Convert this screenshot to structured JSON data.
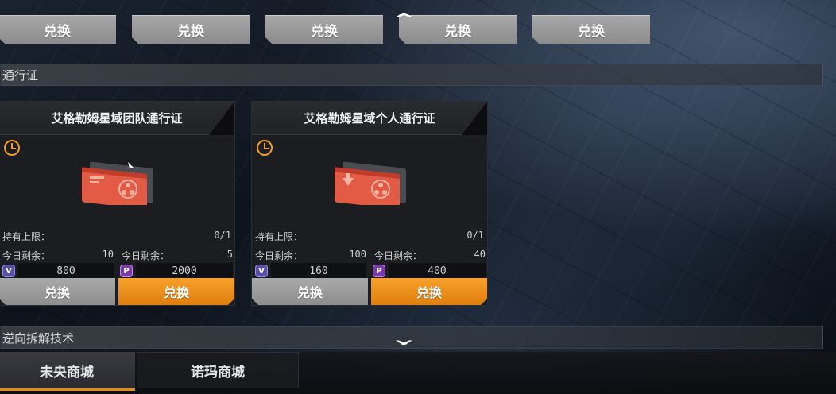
{
  "top_row": {
    "buttons": [
      "兑换",
      "兑换",
      "兑换",
      "兑换",
      "兑换"
    ]
  },
  "sections": {
    "pass": "通行证",
    "reverse": "逆向拆解技术"
  },
  "cards": [
    {
      "title": "艾格勒姆星域团队通行证",
      "hold_label": "持有上限：",
      "hold_value": "0/1",
      "today_label_1": "今日剩余：",
      "today_value_1": "10",
      "today_label_2": "今日剩余：",
      "today_value_2": "5",
      "price_1": "800",
      "price_2": "2000",
      "btn_1": "兑换",
      "btn_2": "兑换"
    },
    {
      "title": "艾格勒姆星域个人通行证",
      "hold_label": "持有上限：",
      "hold_value": "0/1",
      "today_label_1": "今日剩余：",
      "today_value_1": "100",
      "today_label_2": "今日剩余：",
      "today_value_2": "40",
      "price_1": "160",
      "price_2": "400",
      "btn_1": "兑换",
      "btn_2": "兑换"
    }
  ],
  "tabs": {
    "tab_1": "未央商城",
    "tab_2": "诺玛商城"
  },
  "colors": {
    "accent": "#e38a18",
    "button_grey": "#9a9a9a",
    "clock": "#f0a020"
  },
  "icons": {
    "scroll_up": "chevron-up-icon",
    "scroll_down": "chevron-down-icon",
    "currency_1": "v-currency-icon",
    "currency_2": "p-currency-icon"
  }
}
